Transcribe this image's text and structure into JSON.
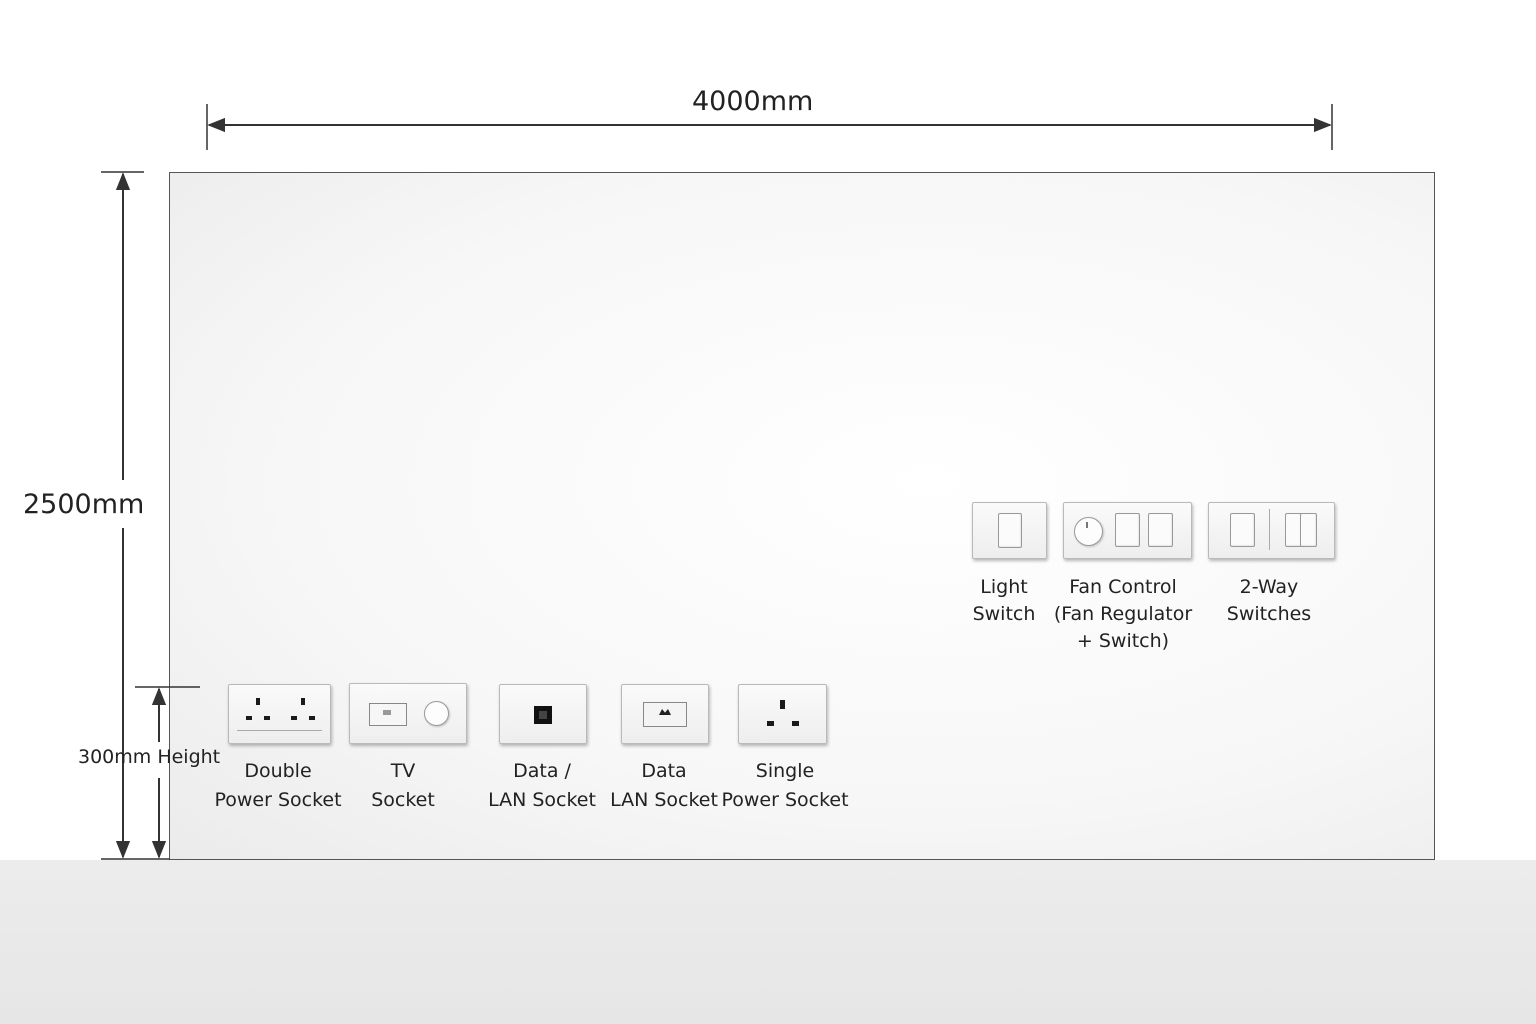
{
  "dimensions": {
    "width_label": "4000mm",
    "height_label": "2500mm",
    "socket_height_label": "300mm Height"
  },
  "fixtures": {
    "double_power_socket": {
      "line1": "Double",
      "line2": "Power Socket",
      "icon": "double-power-socket-icon"
    },
    "tv_socket": {
      "line1": "TV",
      "line2": "Socket",
      "icon": "tv-socket-icon"
    },
    "data_lan_socket_1": {
      "line1": "Data /",
      "line2": "LAN Socket",
      "icon": "data-lan-socket-icon"
    },
    "data_lan_socket_2": {
      "line1": "Data",
      "line2": "LAN Socket",
      "icon": "data-lan-socket-icon"
    },
    "single_power_socket": {
      "line1": "Single",
      "line2": "Power Socket",
      "icon": "single-power-socket-icon"
    },
    "light_switch": {
      "line1": "Light",
      "line2": "Switch",
      "icon": "light-switch-icon"
    },
    "fan_control": {
      "line1": "Fan Control",
      "line2": "(Fan Regulator",
      "line3": "+ Switch)",
      "icon": "fan-regulator-icon"
    },
    "two_way_switches": {
      "line1": "2-Way",
      "line2": "Switches",
      "icon": "two-way-switch-icon"
    }
  },
  "colors": {
    "wall": "#f7f7f7",
    "floor": "#e8e8e8",
    "dimension_lines": "#333333"
  }
}
